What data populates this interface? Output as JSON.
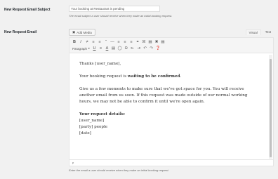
{
  "subject": {
    "label": "New Request Email Subject",
    "value": "Your booking at Restaurant is pending",
    "description": "The email subject a user should receive when they make an initial booking request."
  },
  "email": {
    "label": "New Request Email",
    "add_media": "Add Media",
    "tabs": {
      "visual": "Visual",
      "text": "Text"
    },
    "format_select": "Paragraph",
    "content": {
      "greeting": "Thanks [user_name],",
      "status_prefix": "Your booking request is ",
      "status_bold": "waiting to be confirmed",
      "status_suffix": ".",
      "body": "Give us a few moments to make sure that we've got space for you. You will receive another email from us soon. If this request was made outside of our normal working hours, we may not be able to confirm it until we're open again.",
      "details_heading": "Your request details:",
      "details": [
        "[user_name]",
        "[party] people",
        "[date]"
      ]
    },
    "path": "p",
    "description": "Enter the email a user should receive when they make an initial booking request."
  }
}
